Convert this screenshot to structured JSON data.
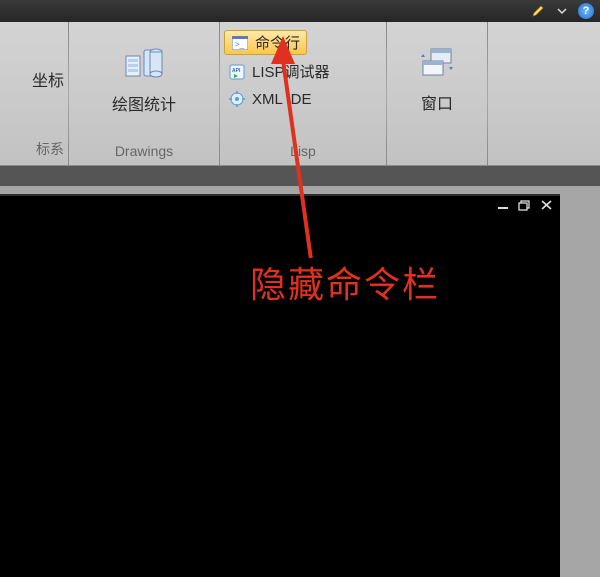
{
  "titlebar": {
    "pencil_icon": "pencil-icon",
    "dropdown_icon": "chevron-down-icon",
    "help_icon": "help-icon"
  },
  "ribbon": {
    "panel0": {
      "big": "坐标",
      "label": "标系"
    },
    "panel1": {
      "big": "绘图统计",
      "label": "Drawings"
    },
    "panel2": {
      "cmdline": "命令行",
      "lisp_debugger": "LISP调试器",
      "xml_ide": "XML IDE",
      "label": "Lisp"
    },
    "panel3": {
      "big": "窗口"
    }
  },
  "annotation": {
    "text": "隐藏命令栏"
  }
}
